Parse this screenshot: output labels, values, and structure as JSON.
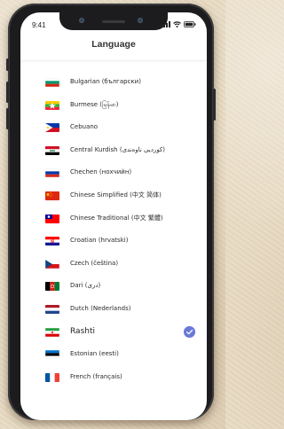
{
  "status_bar": {
    "time": "9:41"
  },
  "header": {
    "title": "Language"
  },
  "languages": [
    {
      "label": "Bulgarian (български)",
      "flag": "bulgaria-flag-icon"
    },
    {
      "label": "Burmese (မြန်မာ)",
      "flag": "myanmar-flag-icon"
    },
    {
      "label": "Cebuano",
      "flag": "philippines-flag-icon"
    },
    {
      "label": "Central Kurdish (کوردیی ناوەندی)",
      "flag": "iraq-flag-icon"
    },
    {
      "label": "Chechen (нохчийн)",
      "flag": "russia-flag-icon"
    },
    {
      "label": "Chinese Simplified (中文 简体)",
      "flag": "china-flag-icon"
    },
    {
      "label": "Chinese Traditional (中文 繁體)",
      "flag": "taiwan-flag-icon"
    },
    {
      "label": "Croatian (hrvatski)",
      "flag": "croatia-flag-icon"
    },
    {
      "label": "Czech (čeština)",
      "flag": "czech-flag-icon"
    },
    {
      "label": "Dari (دری)",
      "flag": "afghanistan-flag-icon"
    },
    {
      "label": "Dutch (Nederlands)",
      "flag": "netherlands-flag-icon"
    },
    {
      "label": "Rashti",
      "flag": "iran-flag-icon",
      "selected": true
    },
    {
      "label": "Estonian (eesti)",
      "flag": "estonia-flag-icon"
    },
    {
      "label": "French (français)",
      "flag": "france-flag-icon"
    }
  ],
  "colors": {
    "accent": "#6a79d8",
    "frame": "#1c1c1e"
  }
}
